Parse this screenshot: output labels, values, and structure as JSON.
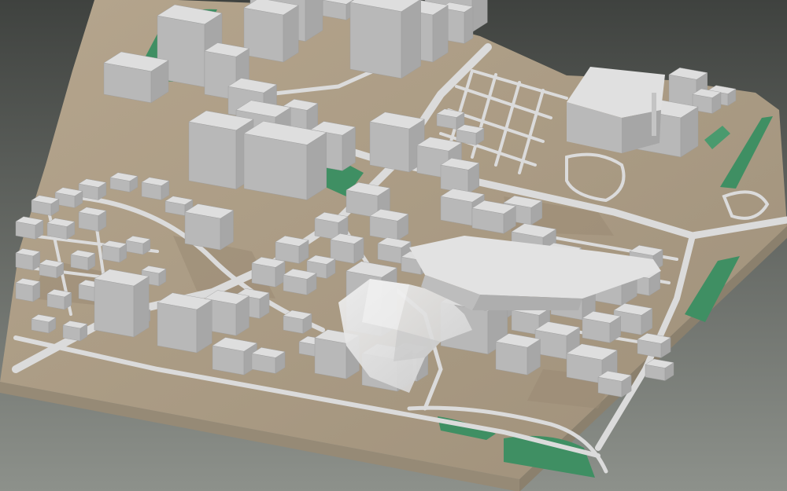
{
  "scene": {
    "description_kind": "3d-city-block-model",
    "colors": {
      "background_top": "#3f423f",
      "background_bottom": "#8d918b",
      "terrain": "#a99a83",
      "terrain_shadow": "#8c7f6c",
      "base_side": "#968a76",
      "road": "#d9d9d9",
      "park": "#3f8f63",
      "park_light": "#5aaa7b",
      "building_top": "#dedede",
      "building_left": "#b8b8b8",
      "building_right": "#a7a7a7",
      "canopy": "#e7e7e7"
    }
  }
}
